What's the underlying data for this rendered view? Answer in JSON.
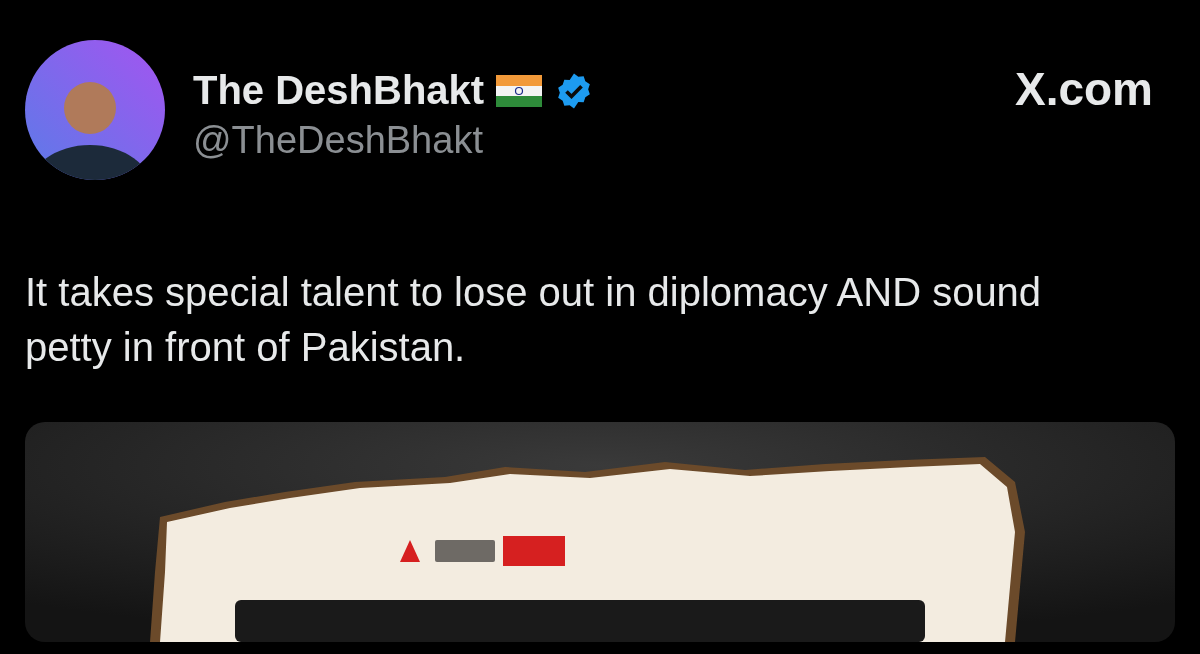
{
  "author": {
    "name": "The DeshBhakt",
    "handle": "@TheDeshBhakt",
    "verified": true
  },
  "site_label": "X.com",
  "tweet": {
    "text": "It takes special talent to lose out in diplomacy AND sound petty in front of Pakistan."
  }
}
